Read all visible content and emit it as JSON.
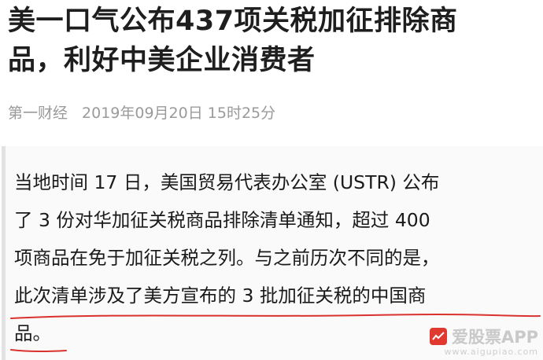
{
  "article": {
    "title_line1": "美一口气公布437项关税加征排除商",
    "title_line2": "品，利好中美企业消费者",
    "source": "第一财经",
    "date": "2019年09月20日 15时25分"
  },
  "quote": {
    "lines": [
      "当地时间 17 日，美国贸易代表办公室 (USTR) 公布",
      "了 3 份对华加征关税商品排除清单通知，超过 400",
      "项商品在免于加征关税之列。与之前历次不同的是，",
      "此次清单涉及了美方宣布的 3 批加征关税的中国商",
      "品。"
    ]
  },
  "annotation": {
    "color": "#d9322f"
  },
  "watermark": {
    "name": "爱股票APP",
    "url": "www.aigupiao.com"
  }
}
